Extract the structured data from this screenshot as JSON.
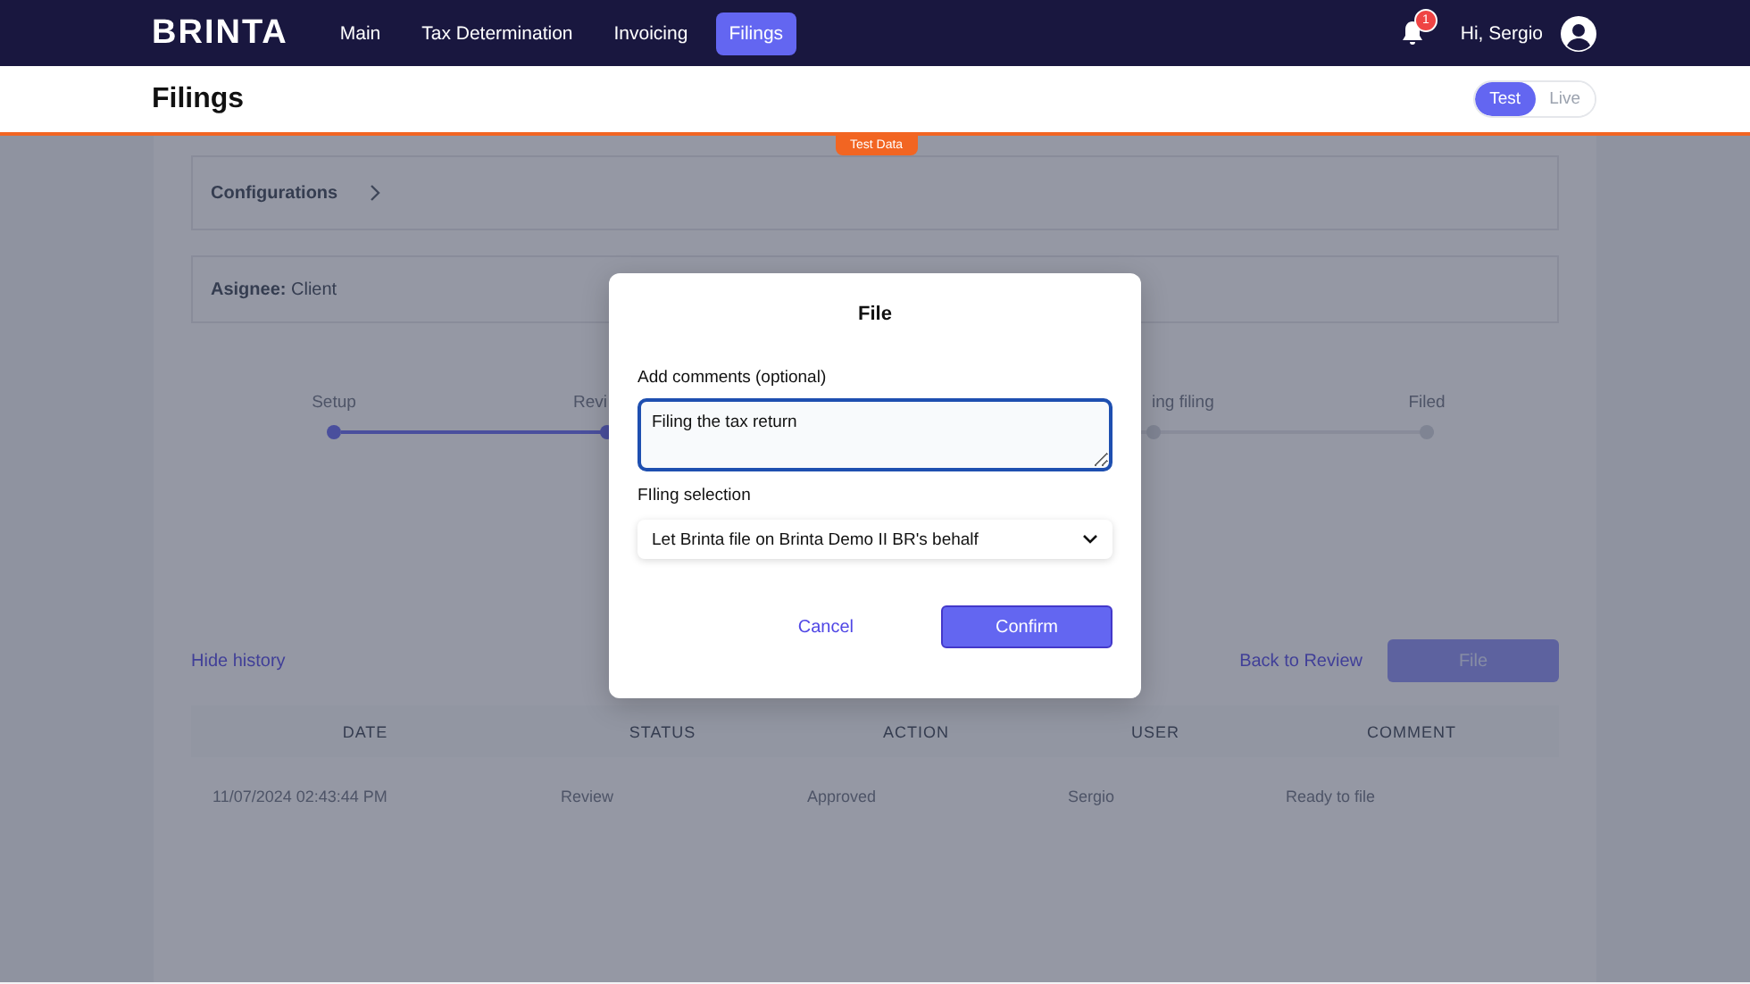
{
  "nav": {
    "logo": "BRINTA",
    "items": [
      {
        "label": "Main",
        "selected": false
      },
      {
        "label": "Tax Determination",
        "selected": false
      },
      {
        "label": "Invoicing",
        "selected": false
      },
      {
        "label": "Filings",
        "selected": true
      }
    ],
    "notifications": "1",
    "greeting": "Hi, Sergio"
  },
  "header": {
    "title": "Filings",
    "modes": [
      {
        "label": "Test",
        "selected": true
      },
      {
        "label": "Live",
        "selected": false
      }
    ],
    "badge": "Test Data"
  },
  "configurations": "Configurations",
  "assignee": {
    "label": "Asignee:",
    "value": "Client"
  },
  "steps": [
    {
      "label": "Setup",
      "completed": true,
      "kind": "full"
    },
    {
      "label": "Revi",
      "completed": true,
      "kind": "clipped_end"
    },
    {
      "label": "ing filing",
      "completed": false,
      "kind": "clipped_start"
    },
    {
      "label": "Filed",
      "completed": false,
      "kind": "full"
    }
  ],
  "history_toggle": "Hide history",
  "back_link": "Back to Review",
  "file_button": {
    "label": "File",
    "disabled": true
  },
  "table": {
    "columns": [
      "DATE",
      "STATUS",
      "ACTION",
      "USER",
      "COMMENT"
    ],
    "rows": [
      [
        "11/07/2024 02:43:44 PM",
        "Review",
        "Approved",
        "Sergio",
        "Ready to file"
      ]
    ]
  },
  "dialog": {
    "title": "File",
    "comment_label": "Add comments (optional)",
    "comment_value": "Filing the tax return",
    "selection_label": "FIling selection",
    "selection_value": "Let Brinta file on Brinta Demo II BR's behalf",
    "cancel": "Cancel",
    "confirm": "Confirm"
  }
}
